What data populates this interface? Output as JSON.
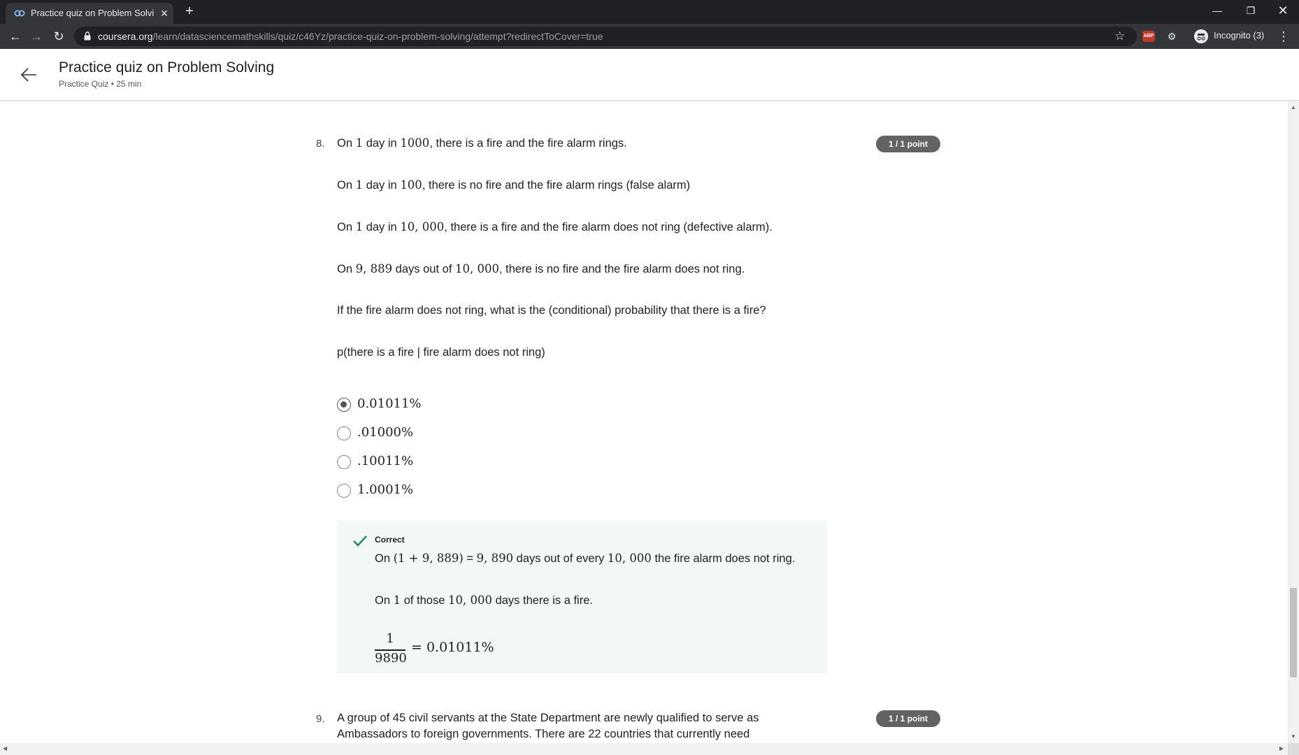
{
  "browser": {
    "tab_title": "Practice quiz on Problem Solving",
    "tab_close": "✕",
    "new_tab": "+",
    "url_host": "coursera.org",
    "url_path": "/learn/datasciencemathskills/quiz/c46Yz/practice-quiz-on-problem-solving/attempt?redirectToCover=true",
    "incognito_label": "Incognito (3)",
    "abp_label": "ABP",
    "icons": [
      "back-arrow-icon",
      "forward-arrow-icon",
      "reload-icon",
      "lock-icon",
      "star-icon",
      "incognito-icon",
      "kebab-menu-icon"
    ]
  },
  "header": {
    "title": "Practice quiz on Problem Solving",
    "subtitle": "Practice Quiz • 25 min"
  },
  "question8": {
    "number": "8.",
    "points": "1 / 1 point",
    "paragraphs": [
      [
        "On ",
        "1",
        " day in ",
        "1000",
        ", there is a fire and the fire alarm rings."
      ],
      [
        "On ",
        "1",
        " day in ",
        "100",
        ", there is no fire and the fire alarm rings (false alarm)"
      ],
      [
        "On ",
        "1",
        " day in ",
        "10, 000",
        ", there is a fire and the fire alarm does not ring (defective alarm)."
      ],
      [
        "On ",
        "9, 889",
        " days out of ",
        "10, 000",
        ", there is no fire and the fire alarm does not ring."
      ]
    ],
    "question": "If the fire alarm does not ring, what is the (conditional) probability that there is a fire?",
    "expression": "p(there is a fire | fire alarm does not ring)",
    "options": [
      {
        "label": "0.01011%",
        "selected": true
      },
      {
        "label": ".01000%",
        "selected": false
      },
      {
        "label": ".10011%",
        "selected": false
      },
      {
        "label": "1.0001%",
        "selected": false
      }
    ],
    "feedback": {
      "status": "Correct",
      "line1": [
        "On ",
        "(1 + 9, 889)",
        " = ",
        "9, 890",
        " days out of every ",
        "10, 000",
        " the fire alarm does not ring."
      ],
      "line2": [
        "On ",
        "1",
        " of those ",
        "10, 000",
        " days there is a fire."
      ],
      "frac_num": "1",
      "frac_den": "9890",
      "frac_result": "= 0.01011%",
      "accent_color": "#1f8354"
    }
  },
  "question9": {
    "number": "9.",
    "points": "1 / 1 point",
    "line1": "A group of 45 civil servants at the State Department are newly qualified to serve as",
    "line2": "Ambassadors to foreign governments. There are 22 countries that currently need"
  }
}
